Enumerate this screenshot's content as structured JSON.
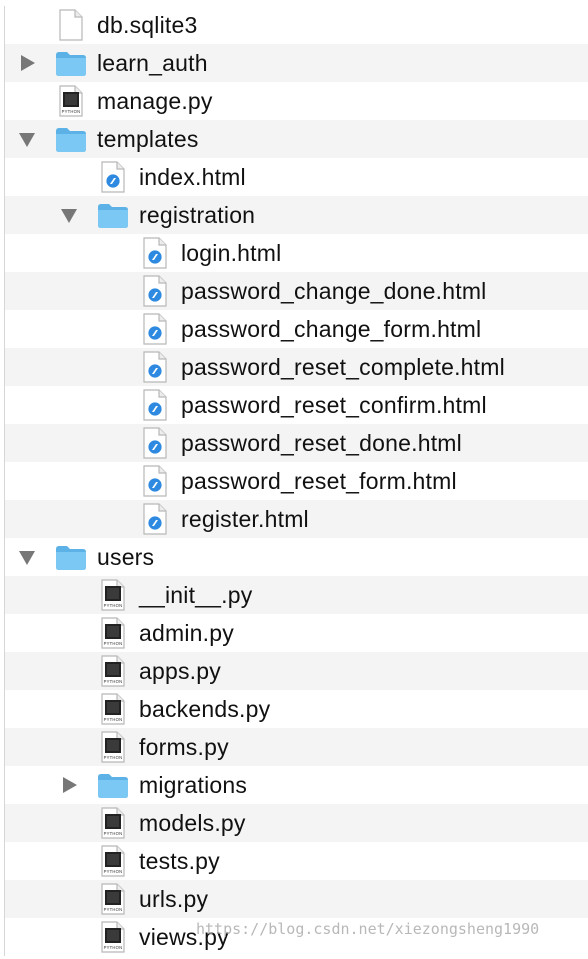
{
  "file_tree": {
    "rows": [
      {
        "depth": 0,
        "type": "file",
        "kind": "blank",
        "name": "db.sqlite3"
      },
      {
        "depth": 0,
        "type": "folder",
        "state": "collapsed",
        "name": "learn_auth"
      },
      {
        "depth": 0,
        "type": "file",
        "kind": "python",
        "name": "manage.py"
      },
      {
        "depth": 0,
        "type": "folder",
        "state": "expanded",
        "name": "templates"
      },
      {
        "depth": 1,
        "type": "file",
        "kind": "html",
        "name": "index.html"
      },
      {
        "depth": 1,
        "type": "folder",
        "state": "expanded",
        "name": "registration"
      },
      {
        "depth": 2,
        "type": "file",
        "kind": "html",
        "name": "login.html"
      },
      {
        "depth": 2,
        "type": "file",
        "kind": "html",
        "name": "password_change_done.html"
      },
      {
        "depth": 2,
        "type": "file",
        "kind": "html",
        "name": "password_change_form.html"
      },
      {
        "depth": 2,
        "type": "file",
        "kind": "html",
        "name": "password_reset_complete.html"
      },
      {
        "depth": 2,
        "type": "file",
        "kind": "html",
        "name": "password_reset_confirm.html"
      },
      {
        "depth": 2,
        "type": "file",
        "kind": "html",
        "name": "password_reset_done.html"
      },
      {
        "depth": 2,
        "type": "file",
        "kind": "html",
        "name": "password_reset_form.html"
      },
      {
        "depth": 2,
        "type": "file",
        "kind": "html",
        "name": "register.html"
      },
      {
        "depth": 0,
        "type": "folder",
        "state": "expanded",
        "name": "users"
      },
      {
        "depth": 1,
        "type": "file",
        "kind": "python",
        "name": "__init__.py"
      },
      {
        "depth": 1,
        "type": "file",
        "kind": "python",
        "name": "admin.py"
      },
      {
        "depth": 1,
        "type": "file",
        "kind": "python",
        "name": "apps.py"
      },
      {
        "depth": 1,
        "type": "file",
        "kind": "python",
        "name": "backends.py"
      },
      {
        "depth": 1,
        "type": "file",
        "kind": "python",
        "name": "forms.py"
      },
      {
        "depth": 1,
        "type": "folder",
        "state": "collapsed",
        "name": "migrations"
      },
      {
        "depth": 1,
        "type": "file",
        "kind": "python",
        "name": "models.py"
      },
      {
        "depth": 1,
        "type": "file",
        "kind": "python",
        "name": "tests.py"
      },
      {
        "depth": 1,
        "type": "file",
        "kind": "python",
        "name": "urls.py"
      },
      {
        "depth": 1,
        "type": "file",
        "kind": "python",
        "name": "views.py"
      }
    ]
  },
  "icons": {
    "python_badge_text": "PYTHON"
  },
  "colors": {
    "folder": "#7cc8f4",
    "folder_dark": "#5cb2e6",
    "html_badge": "#2d8ae0",
    "arrow": "#777777",
    "row_alt": "#f4f4f4"
  },
  "watermark": {
    "text": "https://blog.csdn.net/xiezongsheng1990"
  }
}
